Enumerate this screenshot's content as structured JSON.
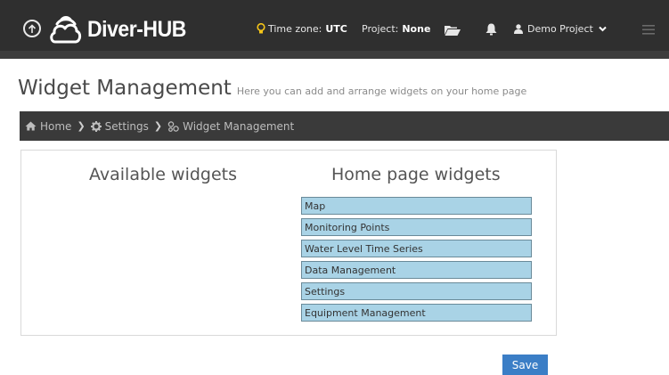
{
  "app": {
    "name": "Diver-HUB"
  },
  "navbar": {
    "timezone_label": "Time zone:",
    "timezone_value": "UTC",
    "project_label": "Project:",
    "project_value": "None",
    "user_menu_label": "Demo Project"
  },
  "page": {
    "title": "Widget Management",
    "subtitle": "Here you can add and arrange widgets on your home page"
  },
  "breadcrumb": {
    "items": [
      {
        "label": "Home",
        "icon": "home-icon"
      },
      {
        "label": "Settings",
        "icon": "cog-icon"
      },
      {
        "label": "Widget Management",
        "icon": "widgets-icon"
      }
    ]
  },
  "columns": {
    "available_title": "Available widgets",
    "home_title": "Home page widgets"
  },
  "home_widgets": [
    "Map",
    "Monitoring Points",
    "Water Level Time Series",
    "Data Management",
    "Settings",
    "Equipment Management"
  ],
  "actions": {
    "save_label": "Save"
  },
  "colors": {
    "navbar_bg": "#2f2f2f",
    "breadcrumb_bg": "#3a3a3a",
    "widget_bg": "#a9d3e6",
    "save_button": "#3b7ec6",
    "lightbulb": "#f5c518"
  }
}
